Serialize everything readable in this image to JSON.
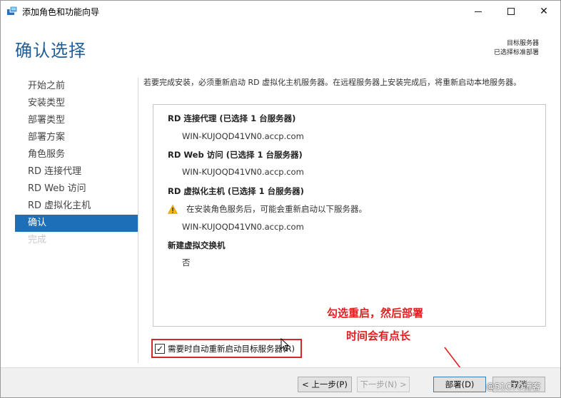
{
  "window": {
    "title": "添加角色和功能向导",
    "icon": "server-manager-icon",
    "controls": {
      "minimize": "minimize-icon",
      "maximize": "maximize-icon",
      "close": "✕"
    }
  },
  "header": {
    "page_title": "确认选择",
    "target_label": "目标服务器",
    "target_value": "已选择标准部署"
  },
  "sidebar": {
    "items": [
      {
        "label": "开始之前",
        "state": "normal"
      },
      {
        "label": "安装类型",
        "state": "normal"
      },
      {
        "label": "部署类型",
        "state": "normal"
      },
      {
        "label": "部署方案",
        "state": "normal"
      },
      {
        "label": "角色服务",
        "state": "normal"
      },
      {
        "label": "RD 连接代理",
        "state": "normal"
      },
      {
        "label": "RD Web 访问",
        "state": "normal"
      },
      {
        "label": "RD 虚拟化主机",
        "state": "normal"
      },
      {
        "label": "确认",
        "state": "active"
      },
      {
        "label": "完成",
        "state": "disabled"
      }
    ]
  },
  "main": {
    "intro": "若要完成安装，必须重新启动 RD 虚拟化主机服务器。在远程服务器上安装完成后，将重新启动本地服务器。",
    "sections": {
      "broker_title": "RD 连接代理  (已选择 1 台服务器)",
      "broker_server": "WIN-KUJOQD41VN0.accp.com",
      "web_title": "RD Web 访问  (已选择 1 台服务器)",
      "web_server": "WIN-KUJOQD41VN0.accp.com",
      "virt_title": "RD 虚拟化主机  (已选择 1 台服务器)",
      "virt_warning": "在安装角色服务后，可能会重新启动以下服务器。",
      "virt_server": "WIN-KUJOQD41VN0.accp.com",
      "switch_title": "新建虚拟交换机",
      "switch_value": "否"
    },
    "restart_checkbox": {
      "label": "需要时自动重新启动目标服务器(R)",
      "checked": true,
      "mark": "✓"
    }
  },
  "annotations": {
    "line1": "勾选重启，然后部署",
    "line2": "时间会有点长",
    "color": "#e0201e"
  },
  "footer": {
    "prev": "< 上一步(P)",
    "next": "下一步(N) >",
    "deploy": "部署(D)",
    "cancel": "取消"
  },
  "watermark": "@51CTO博客"
}
